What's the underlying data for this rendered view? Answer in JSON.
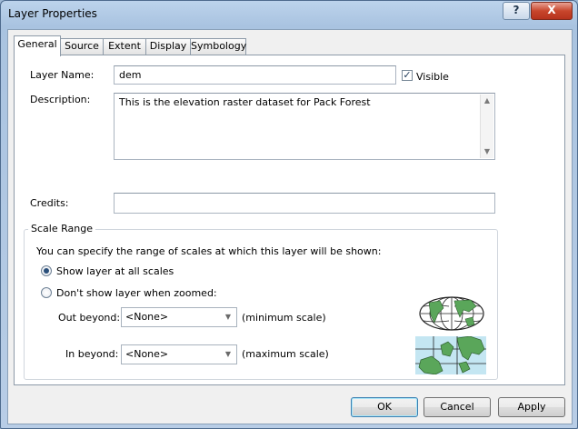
{
  "window": {
    "title": "Layer Properties",
    "help_label": "?",
    "close_label": "X"
  },
  "tabs": [
    {
      "label": "General",
      "active": true
    },
    {
      "label": "Source",
      "active": false
    },
    {
      "label": "Extent",
      "active": false
    },
    {
      "label": "Display",
      "active": false
    },
    {
      "label": "Symbology",
      "active": false
    }
  ],
  "general": {
    "layer_name_label": "Layer Name:",
    "layer_name_value": "dem",
    "visible_label": "Visible",
    "visible_checked": true,
    "visible_check_glyph": "✓",
    "description_label": "Description:",
    "description_value": "This is the elevation raster dataset for Pack Forest",
    "credits_label": "Credits:",
    "credits_value": ""
  },
  "scale_range": {
    "title": "Scale Range",
    "info": "You can specify the range of scales at which this layer will be shown:",
    "option_all": "Show layer at all scales",
    "option_zoomed": "Don't show layer when zoomed:",
    "selected": "option_all",
    "out_beyond_label": "Out beyond:",
    "out_beyond_value": "<None>",
    "out_beyond_hint": "(minimum scale)",
    "in_beyond_label": "In beyond:",
    "in_beyond_value": "<None>",
    "in_beyond_hint": "(maximum scale)",
    "globe_icon": "globe-icon",
    "map_icon": "zoomed-map-icon"
  },
  "buttons": {
    "ok": "OK",
    "cancel": "Cancel",
    "apply": "Apply"
  },
  "colors": {
    "titlebar": "#a9c3e0",
    "close_button": "#c8462c",
    "radio_dot": "#2a4f7a",
    "land_green": "#5aa65a",
    "water_blue": "#c4e6f2"
  }
}
